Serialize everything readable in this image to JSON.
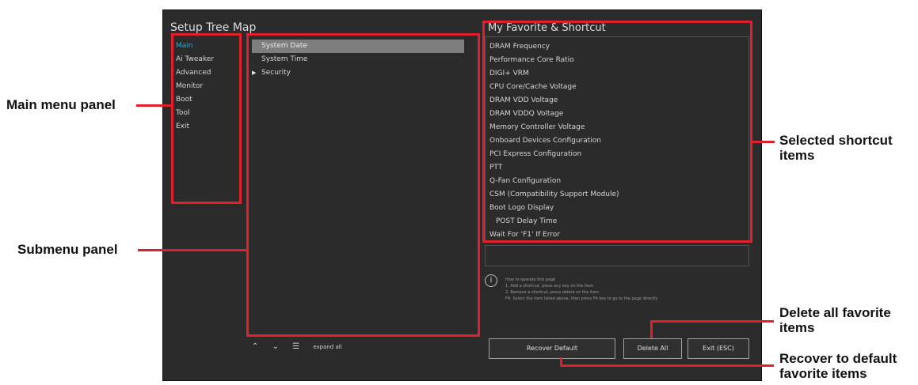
{
  "bios": {
    "main_title": "Setup Tree Map",
    "main_menu": [
      "Main",
      "Ai Tweaker",
      "Advanced",
      "Monitor",
      "Boot",
      "Tool",
      "Exit"
    ],
    "submenu": [
      {
        "label": "System Date",
        "selected": true
      },
      {
        "label": "System Time"
      },
      {
        "label": "Security",
        "arrow": "▶"
      }
    ],
    "favorites_title": "My Favorite & Shortcut",
    "favorites": [
      "DRAM Frequency",
      "Performance Core Ratio",
      "DIGI+ VRM",
      "CPU Core/Cache Voltage",
      "DRAM VDD Voltage",
      "DRAM VDDQ Voltage",
      "Memory Controller Voltage",
      "Onboard Devices Configuration",
      "PCI Express Configuration",
      "PTT",
      "Q-Fan Configuration",
      "CSM (Compatibility Support Module)",
      "Boot Logo Display",
      "POST Delay Time",
      "Wait For 'F1' If Error"
    ],
    "info_lines": [
      "How to operate this page",
      "1. Add a shortcut, press any key on the item",
      "2. Remove a shortcut, press delete on the item",
      "F4: Select the item listed above, then press F4 key to go to the page directly"
    ],
    "toolbar": {
      "collapse": "⌃",
      "expand": "⌄",
      "expand_label": "expand all"
    },
    "buttons": {
      "recover": "Recover Default",
      "delete": "Delete All",
      "exit": "Exit (ESC)"
    }
  },
  "callouts": {
    "main_menu": "Main menu panel",
    "submenu": "Submenu panel",
    "shortcut_line1": "Selected shortcut",
    "shortcut_line2": "items",
    "delete_line1": "Delete all favorite",
    "delete_line2": "items",
    "recover_line1": "Recover to default",
    "recover_line2": "favorite items"
  },
  "colors": {
    "highlight": "#e0202a",
    "selected_main": "#1ea8e0",
    "bios_bg": "#2b2b2b"
  }
}
